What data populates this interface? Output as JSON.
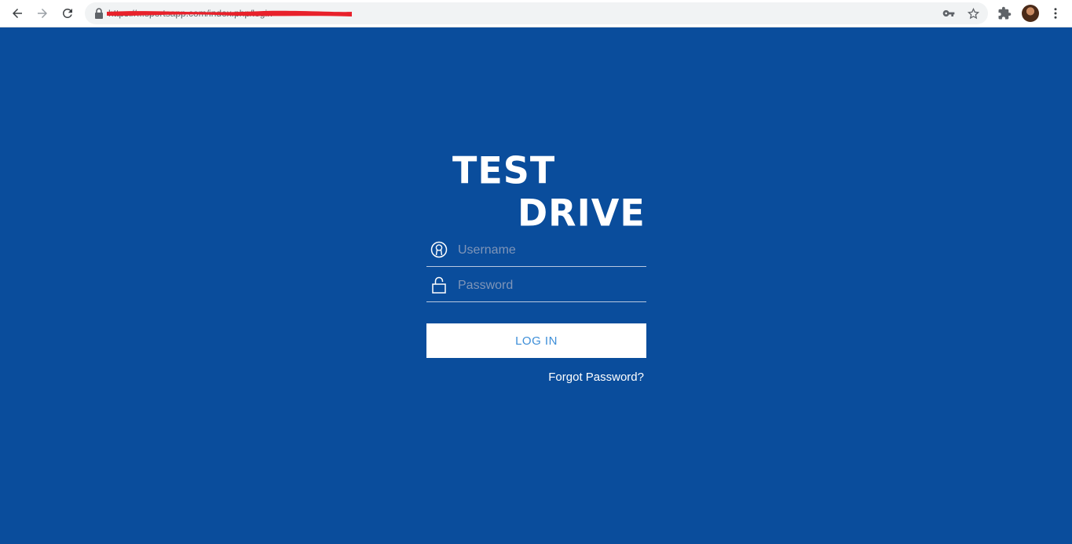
{
  "browser": {
    "url": "https://...sportsapp.com/index.php/login",
    "nav_icons": [
      "back-icon",
      "forward-icon",
      "reload-icon"
    ],
    "omnibox_icons": [
      "key-icon",
      "star-icon"
    ],
    "toolbar_icons": [
      "extensions-icon",
      "avatar",
      "menu-icon"
    ]
  },
  "logo": {
    "line1": "TEST",
    "line2": "DRIVE"
  },
  "form": {
    "username_placeholder": "Username",
    "password_placeholder": "Password",
    "login_label": "LOG IN",
    "forgot_label": "Forgot Password?"
  },
  "colors": {
    "background": "#0a4d9c",
    "button_text": "#3d8ed8",
    "placeholder": "#7f95b8"
  }
}
